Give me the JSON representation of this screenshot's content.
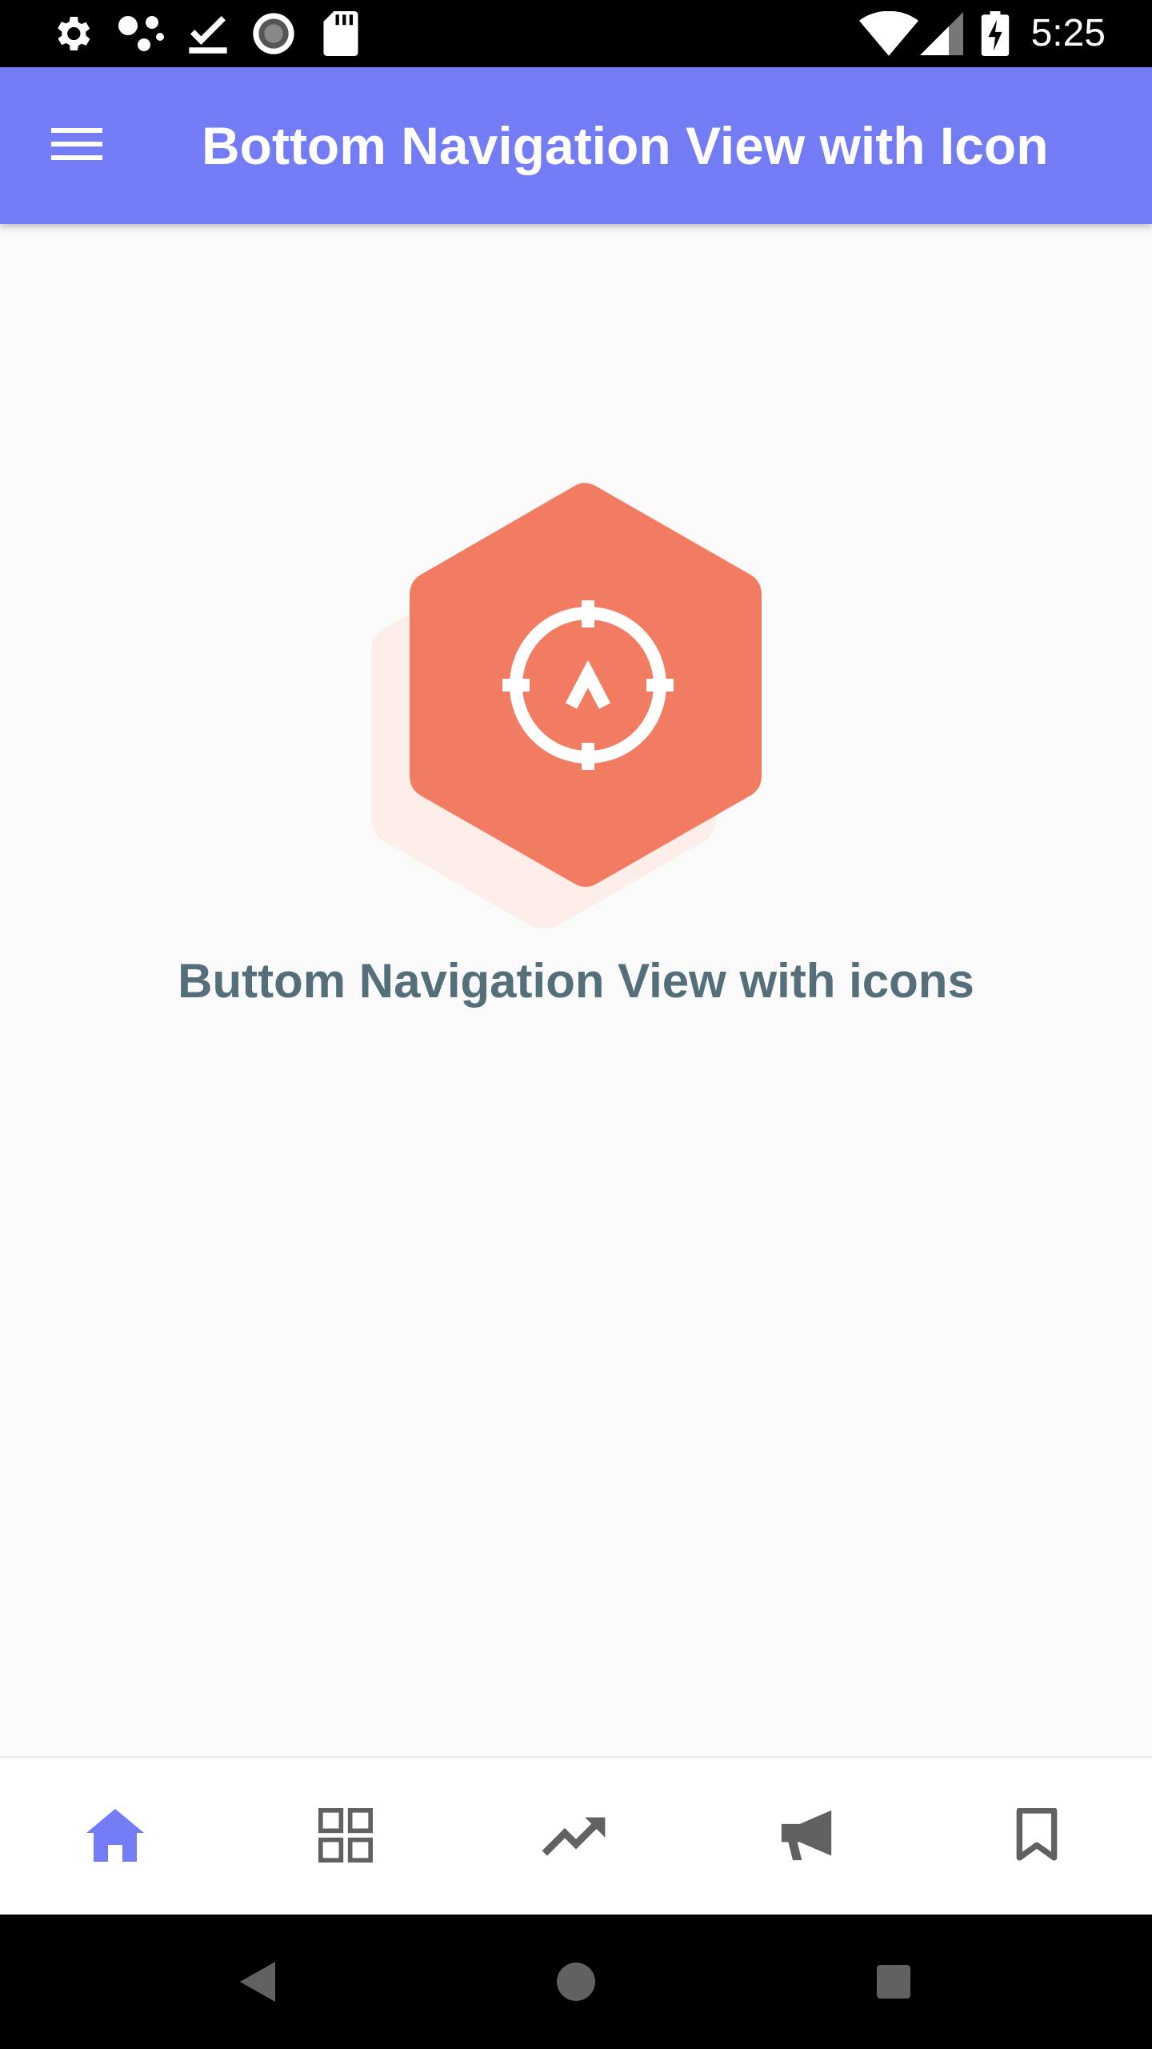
{
  "status_bar": {
    "time": "5:25",
    "left_icons": [
      "settings-icon",
      "share-dots-icon",
      "download-done-icon",
      "loading-circle-icon",
      "sd-card-icon"
    ],
    "right_icons": [
      "wifi-icon",
      "signal-icon",
      "battery-charging-icon"
    ]
  },
  "app_bar": {
    "title": "Bottom Navigation View with Icon",
    "menu_icon": "hamburger-menu-icon",
    "background": "#737bf5"
  },
  "main": {
    "logo_icon": "hexagon-compass-logo",
    "logo_color": "#f27c62",
    "caption": "Buttom Navigation View with icons"
  },
  "bottom_nav": {
    "active_color": "#737bf5",
    "inactive_color": "#616161",
    "items": [
      {
        "icon": "home-icon",
        "active": true
      },
      {
        "icon": "grid-icon",
        "active": false
      },
      {
        "icon": "trending-up-icon",
        "active": false
      },
      {
        "icon": "megaphone-icon",
        "active": false
      },
      {
        "icon": "bookmark-icon",
        "active": false
      }
    ]
  },
  "system_nav": {
    "icons": [
      "back-icon",
      "home-circle-icon",
      "recents-icon"
    ]
  }
}
